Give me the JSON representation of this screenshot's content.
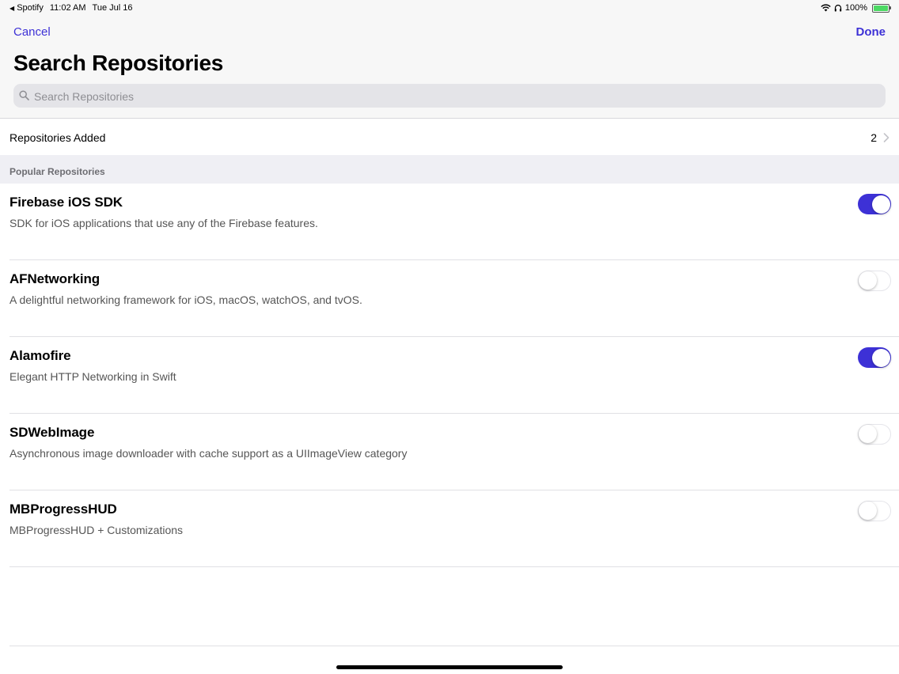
{
  "status_bar": {
    "back_app": "Spotify",
    "time": "11:02 AM",
    "date": "Tue Jul 16",
    "battery": "100%"
  },
  "nav": {
    "cancel_label": "Cancel",
    "done_label": "Done",
    "title": "Search Repositories"
  },
  "search": {
    "placeholder": "Search Repositories",
    "value": ""
  },
  "added": {
    "label": "Repositories Added",
    "count": "2"
  },
  "section": {
    "label": "Popular Repositories"
  },
  "repositories": [
    {
      "name": "Firebase iOS SDK",
      "description": "SDK for iOS applications that use any of the Firebase features.",
      "enabled": true
    },
    {
      "name": "AFNetworking",
      "description": "A delightful networking framework for iOS, macOS, watchOS, and tvOS.",
      "enabled": false
    },
    {
      "name": "Alamofire",
      "description": "Elegant HTTP Networking in Swift",
      "enabled": true
    },
    {
      "name": "SDWebImage",
      "description": "Asynchronous image downloader with cache support as a UIImageView category",
      "enabled": false
    },
    {
      "name": "MBProgressHUD",
      "description": "MBProgressHUD + Customizations",
      "enabled": false
    }
  ],
  "colors": {
    "accent": "#3d31d6",
    "toggle_off_border": "#e5e5ea"
  }
}
